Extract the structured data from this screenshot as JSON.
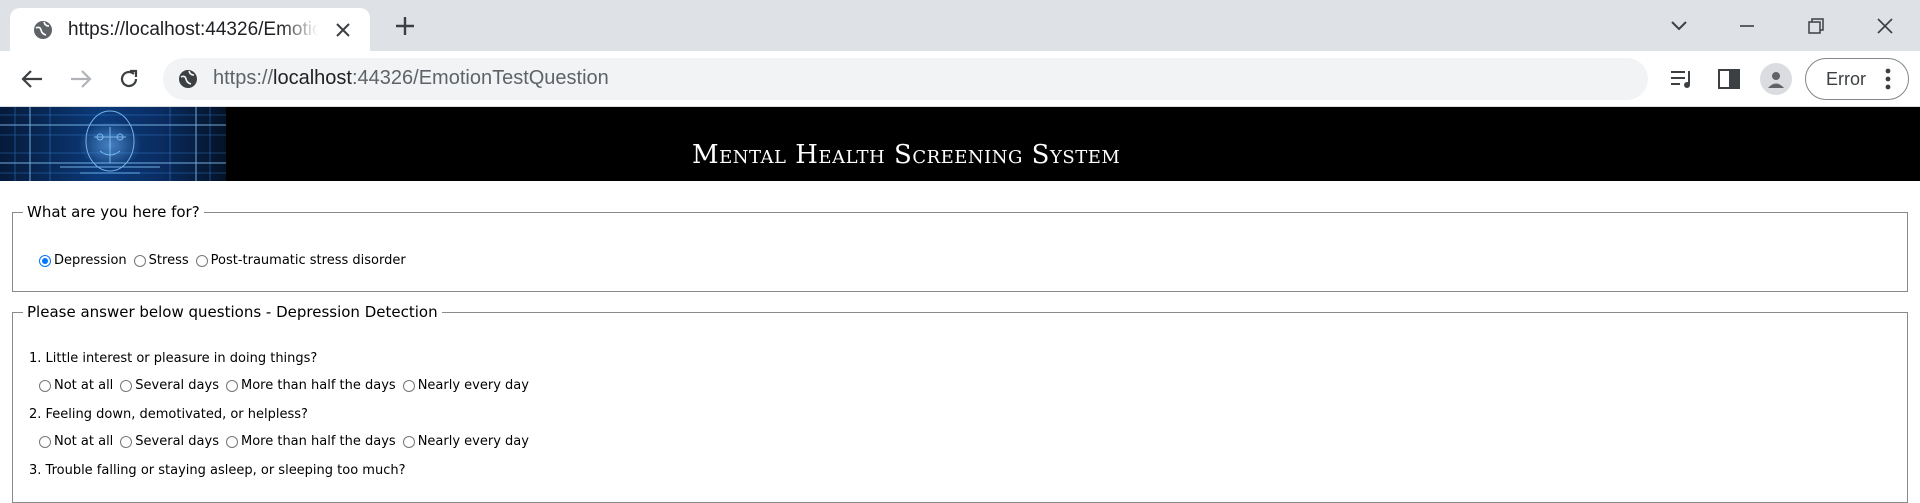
{
  "browser": {
    "tab_title": "https://localhost:44326/EmotionTestQuestion",
    "url_scheme": "https://",
    "url_host": "localhost",
    "url_rest": ":44326/EmotionTestQuestion",
    "profile_button_label": "Error"
  },
  "header": {
    "site_title": "Mental Health Screening System"
  },
  "purpose": {
    "legend": "What are you here for?",
    "options": [
      {
        "label": "Depression",
        "selected": true
      },
      {
        "label": "Stress",
        "selected": false
      },
      {
        "label": "Post-traumatic stress disorder",
        "selected": false
      }
    ]
  },
  "questionnaire": {
    "legend": "Please answer below questions - Depression Detection",
    "answer_options": [
      "Not at all",
      "Several days",
      "More than half the days",
      "Nearly every day"
    ],
    "questions": [
      "1. Little interest or pleasure in doing things?",
      "2. Feeling down, demotivated, or helpless?",
      "3. Trouble falling or staying asleep, or sleeping too much?"
    ]
  },
  "colors": {
    "banner_bg": "#000000",
    "accent": "#0075ff",
    "tabstrip_bg": "#dee1e6"
  }
}
